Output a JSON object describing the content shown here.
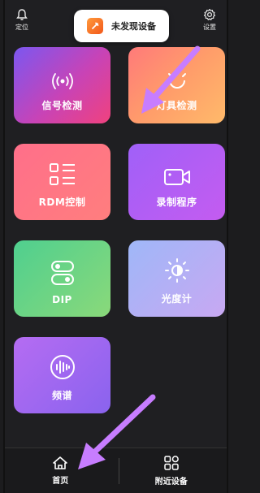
{
  "header": {
    "locate_label": "定位",
    "settings_label": "设置",
    "status_text": "未发现设备"
  },
  "tiles": [
    {
      "label": "信号检测",
      "icon": "signal-icon"
    },
    {
      "label": "灯具检测",
      "icon": "lamp-icon"
    },
    {
      "label": "RDM控制",
      "icon": "list-icon"
    },
    {
      "label": "录制程序",
      "icon": "video-icon"
    },
    {
      "label": "DIP",
      "icon": "toggle-icon"
    },
    {
      "label": "光度计",
      "icon": "brightness-icon"
    },
    {
      "label": "频谱",
      "icon": "waveform-icon"
    }
  ],
  "bottom_nav": [
    {
      "label": "首页",
      "icon": "home-icon",
      "active": true
    },
    {
      "label": "附近设备",
      "icon": "nearby-devices-icon",
      "active": false
    }
  ],
  "colors": {
    "background": "#1f1f22",
    "annotation_arrow": "#c77dff"
  }
}
